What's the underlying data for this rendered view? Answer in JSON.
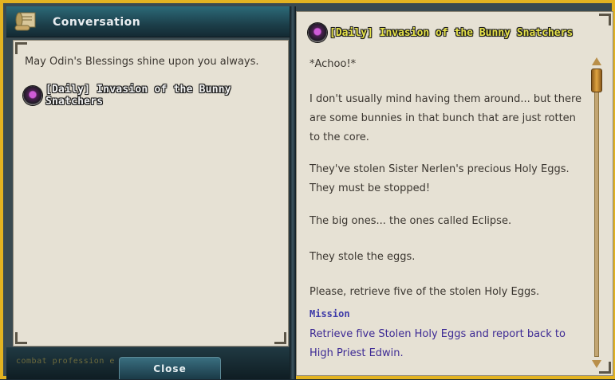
{
  "window": {
    "title": "Conversation"
  },
  "left": {
    "greeting": "May Odin's Blessings shine upon you always.",
    "quest_link": "[Daily] Invasion of the Bunny Snatchers",
    "bottom_text": "combat profession e",
    "close_label": "Close"
  },
  "right": {
    "title": "[Daily] Invasion of the Bunny Snatchers",
    "paragraphs": [
      "*Achoo!*",
      "I don't usually mind having them around... but there are some bunnies in that bunch that are just rotten to the core.",
      "They've stolen Sister Nerlen's precious Holy Eggs. They must be stopped!",
      "The big ones... the ones called Eclipse.",
      "They stole the eggs.",
      "Please, retrieve five of the stolen Holy Eggs."
    ],
    "mission_label": "Mission",
    "mission_text": "Retrieve five Stolen Holy Eggs and report back to High Priest Edwin."
  },
  "colors": {
    "frame_border": "#e3b321",
    "parchment": "#e6e1d4",
    "quest_title": "#e6e24a",
    "mission": "#3d2a94"
  },
  "icons": {
    "window": "scroll-icon",
    "quest": "quest-orb-icon"
  }
}
